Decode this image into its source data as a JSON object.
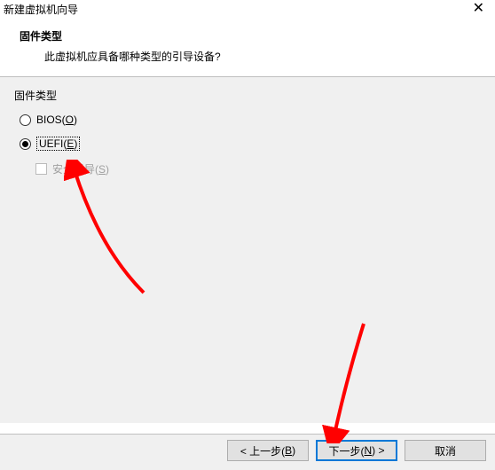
{
  "window": {
    "title": "新建虚拟机向导"
  },
  "header": {
    "title": "固件类型",
    "subtitle": "此虚拟机应具备哪种类型的引导设备?"
  },
  "group": {
    "label": "固件类型"
  },
  "options": {
    "bios": {
      "text_prefix": "BIOS(",
      "mnemonic": "O",
      "text_suffix": ")",
      "selected": false
    },
    "uefi": {
      "text_prefix": "UEFI(",
      "mnemonic": "E",
      "text_suffix": ")",
      "selected": true
    },
    "secure_boot": {
      "text_prefix": "安全引导(",
      "mnemonic": "S",
      "text_suffix": ")",
      "enabled": false,
      "checked": false
    }
  },
  "buttons": {
    "back": {
      "prefix": "< 上一步(",
      "mnemonic": "B",
      "suffix": ")"
    },
    "next": {
      "prefix": "下一步(",
      "mnemonic": "N",
      "suffix": ") >"
    },
    "cancel": {
      "label": "取消"
    }
  },
  "colors": {
    "background_content": "#f0f0f0",
    "accent": "#0078d7",
    "arrow": "#ff0000"
  }
}
